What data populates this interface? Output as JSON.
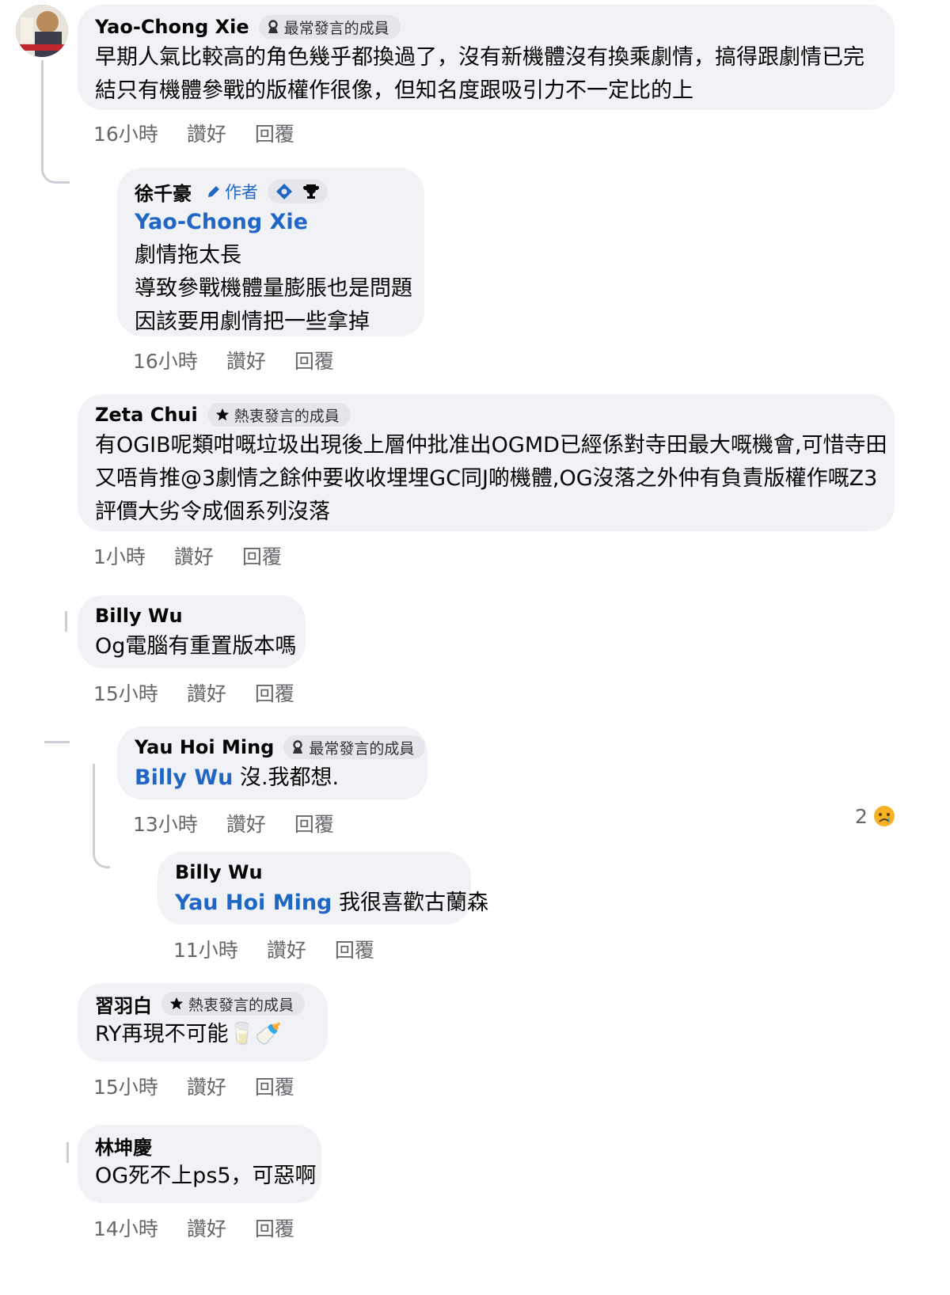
{
  "comments": [
    {
      "name": "Yao-Chong Xie",
      "badge": "最常發言的成員",
      "lines": [
        "早期人氣比較高的角色幾乎都換過了，沒有新機體沒有換乘劇情，搞得跟劇情已完",
        "結只有機體參戰的版權作很像，但知名度跟吸引力不一定比的上"
      ],
      "time": "16小時",
      "like": "讚好",
      "reply": "回覆"
    },
    {
      "name": "徐千豪",
      "author_tag": "作者",
      "mention": "Yao-Chong Xie",
      "lines": [
        "劇情拖太長",
        "導致參戰機體量膨脹也是問題",
        "因該要用劇情把一些拿掉"
      ],
      "time": "16小時",
      "like": "讚好",
      "reply": "回覆"
    },
    {
      "name": "Zeta Chui",
      "badge": "熱衷發言的成員",
      "lines": [
        "有OGIB呢類咁嘅垃圾出現後上層仲批准出OGMD已經係對寺田最大嘅機會,可惜寺田",
        "又唔肯推@3劇情之餘仲要收收埋埋GC同J啲機體,OG沒落之外仲有負責版權作嘅Z3",
        "評價大劣令成個系列沒落"
      ],
      "time": "1小時",
      "like": "讚好",
      "reply": "回覆"
    },
    {
      "name": "Billy Wu",
      "lines": [
        "Og電腦有重置版本嗎"
      ],
      "time": "15小時",
      "like": "讚好",
      "reply": "回覆"
    },
    {
      "name": "Yau Hoi Ming",
      "badge": "最常發言的成員",
      "mention": "Billy Wu",
      "text": "沒.我都想.",
      "time": "13小時",
      "like": "讚好",
      "reply": "回覆",
      "reaction_count": "2"
    },
    {
      "name": "Billy Wu",
      "mention": "Yau Hoi Ming",
      "text": "我很喜歡古蘭森",
      "time": "11小時",
      "like": "讚好",
      "reply": "回覆"
    },
    {
      "name": "習羽白",
      "badge": "熱衷發言的成員",
      "text": "RY再現不可能🥛🍼",
      "time": "15小時",
      "like": "讚好",
      "reply": "回覆"
    },
    {
      "name": "林坤慶",
      "text": "OG死不上ps5，可惡啊",
      "time": "14小時",
      "like": "讚好",
      "reply": "回覆"
    }
  ],
  "colors": {
    "bubble": "#f0f2f5",
    "mention": "#1f66c5",
    "meta": "#65676b"
  }
}
